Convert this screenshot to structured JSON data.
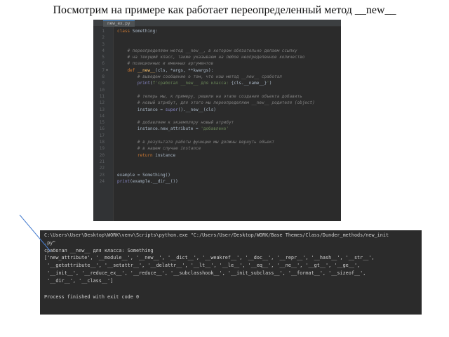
{
  "title": "Посмотрим на примере как работает переопределенный метод __new__",
  "editor": {
    "tab_label": "new_ex.py",
    "lines": [
      {
        "n": "1",
        "segs": [
          [
            "kw",
            "class "
          ],
          [
            "pl",
            "Something:"
          ]
        ]
      },
      {
        "n": "2",
        "segs": []
      },
      {
        "n": "3",
        "segs": []
      },
      {
        "n": "4",
        "segs": [
          [
            "cm",
            "    # переопределяем метод __new__, в котором обязательно делаем ссылку"
          ]
        ]
      },
      {
        "n": "5",
        "segs": [
          [
            "cm",
            "    # на текущий класс, также указываем на любое неопределенное количество"
          ]
        ]
      },
      {
        "n": "6",
        "segs": [
          [
            "cm",
            "    # позиционных и именных аргументов"
          ]
        ]
      },
      {
        "n": "7",
        "mark": "⊕",
        "segs": [
          [
            "kw",
            "    def "
          ],
          [
            "fn",
            "__new__"
          ],
          [
            "pl",
            "(cls, *args, **kwargs):"
          ]
        ]
      },
      {
        "n": "8",
        "segs": [
          [
            "cm",
            "        # выведем сообщение о том, что наш метод __new__ сработал"
          ]
        ]
      },
      {
        "n": "9",
        "segs": [
          [
            "bi",
            "        print"
          ],
          [
            "pl",
            "("
          ],
          [
            "st",
            "f'сработал __new__ для класса: "
          ],
          [
            "pl",
            "{cls.__name__}"
          ],
          [
            "st",
            "'"
          ],
          [
            "pl",
            ")"
          ]
        ]
      },
      {
        "n": "10",
        "segs": []
      },
      {
        "n": "11",
        "segs": [
          [
            "cm",
            "        # теперь мы, к примеру, решили на этапе создания объекта добавить"
          ]
        ]
      },
      {
        "n": "12",
        "segs": [
          [
            "cm",
            "        # новый атрибут, для этого мы переопределяем __new__ родителя (object)"
          ]
        ]
      },
      {
        "n": "13",
        "segs": [
          [
            "pl",
            "        instance = "
          ],
          [
            "bi",
            "super"
          ],
          [
            "pl",
            "().__new__(cls)"
          ]
        ]
      },
      {
        "n": "14",
        "segs": []
      },
      {
        "n": "15",
        "segs": [
          [
            "cm",
            "        # добавляем к экземпляру новый атрибут"
          ]
        ]
      },
      {
        "n": "16",
        "segs": [
          [
            "pl",
            "        instance.new_attribute = "
          ],
          [
            "st",
            "'добавлено'"
          ]
        ]
      },
      {
        "n": "17",
        "segs": []
      },
      {
        "n": "18",
        "segs": [
          [
            "cm",
            "        # в результате работы функции мы должны вернуть объект"
          ]
        ]
      },
      {
        "n": "19",
        "segs": [
          [
            "cm",
            "        # в нашем случае instance"
          ]
        ]
      },
      {
        "n": "20",
        "segs": [
          [
            "kw",
            "        return "
          ],
          [
            "pl",
            "instance"
          ]
        ]
      },
      {
        "n": "21",
        "segs": []
      },
      {
        "n": "22",
        "segs": []
      },
      {
        "n": "23",
        "segs": [
          [
            "pl",
            "example = Something()"
          ]
        ]
      },
      {
        "n": "24",
        "segs": [
          [
            "bi",
            "print"
          ],
          [
            "pl",
            "(example.__dir__())"
          ]
        ]
      }
    ]
  },
  "terminal": {
    "lines": [
      "C:\\Users\\User\\Desktop\\WORK\\venv\\Scripts\\python.exe \"C:/Users/User/Desktop/WORK/Base Themes/Class/Dunder_methods/new_init",
      ".py\"",
      "сработал __new__ для класса: Something",
      "['new_attribute', '__module__', '__new__', '__dict__', '__weakref__', '__doc__', '__repr__', '__hash__', '__str__',",
      " '__getattribute__', '__setattr__', '__delattr__', '__lt__', '__le__', '__eq__', '__ne__', '__gt__', '__ge__',",
      " '__init__', '__reduce_ex__', '__reduce__', '__subclasshook__', '__init_subclass__', '__format__', '__sizeof__',",
      " '__dir__', '__class__']",
      "",
      "Process finished with exit code 0"
    ]
  }
}
